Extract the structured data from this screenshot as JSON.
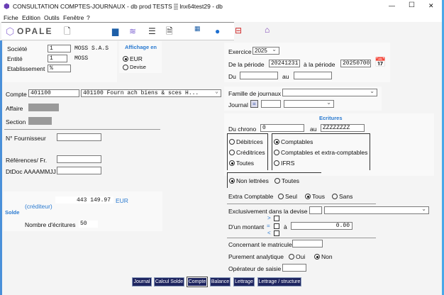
{
  "window": {
    "title": "CONSULTATION COMPTES-JOURNAUX - db prod TESTS ▒ lnx64test29 - db",
    "minimize": "—",
    "maximize": "☐",
    "close": "✕"
  },
  "menu": [
    "Fiche",
    "Edition",
    "Outils",
    "Fenêtre",
    "?"
  ],
  "toolbar": {
    "logo": "OPALE",
    "icons": [
      "new-document-icon",
      "print-icon",
      "layers-icon",
      "help-toggle-icon",
      "search-document-icon",
      "calendar-grid-icon",
      "info-icon",
      "exit-icon",
      "home-icon"
    ]
  },
  "societe": {
    "label": "Société",
    "value": "1",
    "name": "MOSS S.A.S"
  },
  "entite": {
    "label": "Entité",
    "value": "1",
    "name": "MOSS"
  },
  "etablissement": {
    "label": "Etablissement",
    "value": "%"
  },
  "affichage": {
    "title": "Affichage en",
    "options": [
      "EUR",
      "Devise"
    ],
    "selected": "EUR"
  },
  "compte": {
    "label": "Compte",
    "value": "401100",
    "select": "401100 Fourn ach biens & sces H..."
  },
  "affaire": {
    "label": "Affaire"
  },
  "section": {
    "label": "Section"
  },
  "fournisseur": {
    "label": "N° Fournisseur",
    "value": ""
  },
  "references": {
    "label": "Références/ Fr.",
    "value": ""
  },
  "dtdoc": {
    "label": "DtDoc AAAAMMJJ",
    "value": ""
  },
  "solde": {
    "label": "Solde",
    "amount": "443 149.97",
    "currency": "EUR",
    "sens": "(créditeur)",
    "nb_label": "Nombre d'écritures",
    "nb": "50"
  },
  "exercice": {
    "label": "Exercice",
    "value": "2025"
  },
  "periode": {
    "from_label": "De la période",
    "from": "20241231",
    "to_label": "à la période",
    "to": "20250700"
  },
  "du": {
    "label": "Du",
    "value": "",
    "au_label": "au",
    "au": ""
  },
  "famille": {
    "label": "Famille de journaux",
    "value": ""
  },
  "journal": {
    "label": "Journal",
    "code": "",
    "value": ""
  },
  "ecritures": {
    "title": "Ecritures",
    "chrono_label": "Du chrono",
    "from": "0",
    "au_label": "au",
    "to": "ZZZZZZZZ"
  },
  "sens": {
    "options": [
      "Débitrices",
      "Créditrices",
      "Toutes"
    ],
    "selected": "Toutes"
  },
  "type": {
    "options": [
      "Comptables",
      "Comptables et extra-comptables",
      "IFRS"
    ],
    "selected": "Comptables"
  },
  "lettrage": {
    "options": [
      "Non lettrées",
      "Toutes"
    ],
    "selected": "Non lettrées"
  },
  "extra": {
    "label": "Extra Comptable",
    "options": [
      "Seul",
      "Tous",
      "Sans"
    ],
    "selected": "Tous"
  },
  "devise": {
    "label": "Exclusivement dans la devise",
    "code": "",
    "value": ""
  },
  "montant": {
    "label": "D'un montant",
    "ops": [
      ">",
      "=",
      "<"
    ],
    "a_label": "à",
    "value": "0.00"
  },
  "matricule": {
    "label": "Concernant le matricule",
    "value": ""
  },
  "analytique": {
    "label": "Purement analytique",
    "options": [
      "Oui",
      "Non"
    ],
    "selected": "Non"
  },
  "operateur": {
    "label": "Opérateur de saisie",
    "value": ""
  },
  "buttons": [
    "Journal",
    "Calcul Solde",
    "Compte",
    "Balance",
    "Lettrage",
    "Lettrage / structure"
  ],
  "active_button": "Compte"
}
